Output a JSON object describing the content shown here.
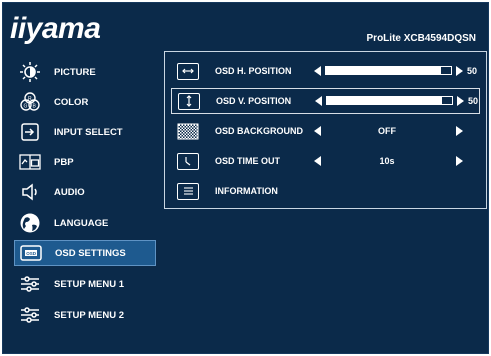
{
  "brand": {
    "logo": "iiyama",
    "model": "ProLite XCB4594DQSN"
  },
  "menu": {
    "items": [
      {
        "label": "PICTURE"
      },
      {
        "label": "COLOR"
      },
      {
        "label": "INPUT SELECT"
      },
      {
        "label": "PBP"
      },
      {
        "label": "AUDIO"
      },
      {
        "label": "LANGUAGE"
      },
      {
        "label": "OSD SETTINGS",
        "active": true
      },
      {
        "label": "SETUP MENU 1"
      },
      {
        "label": "SETUP MENU 2"
      }
    ]
  },
  "submenu": {
    "rows": [
      {
        "label": "OSD H. POSITION",
        "value": "50",
        "level": 0.92
      },
      {
        "label": "OSD V. POSITION",
        "value": "50",
        "level": 0.92,
        "selected": true
      },
      {
        "label": "OSD BACKGROUND",
        "value": "OFF"
      },
      {
        "label": "OSD TIME OUT",
        "value": "10s"
      },
      {
        "label": "INFORMATION"
      }
    ]
  },
  "colors": {
    "background": "#0b2a4a",
    "active": "#1e5a8f",
    "text": "#ffffff"
  }
}
